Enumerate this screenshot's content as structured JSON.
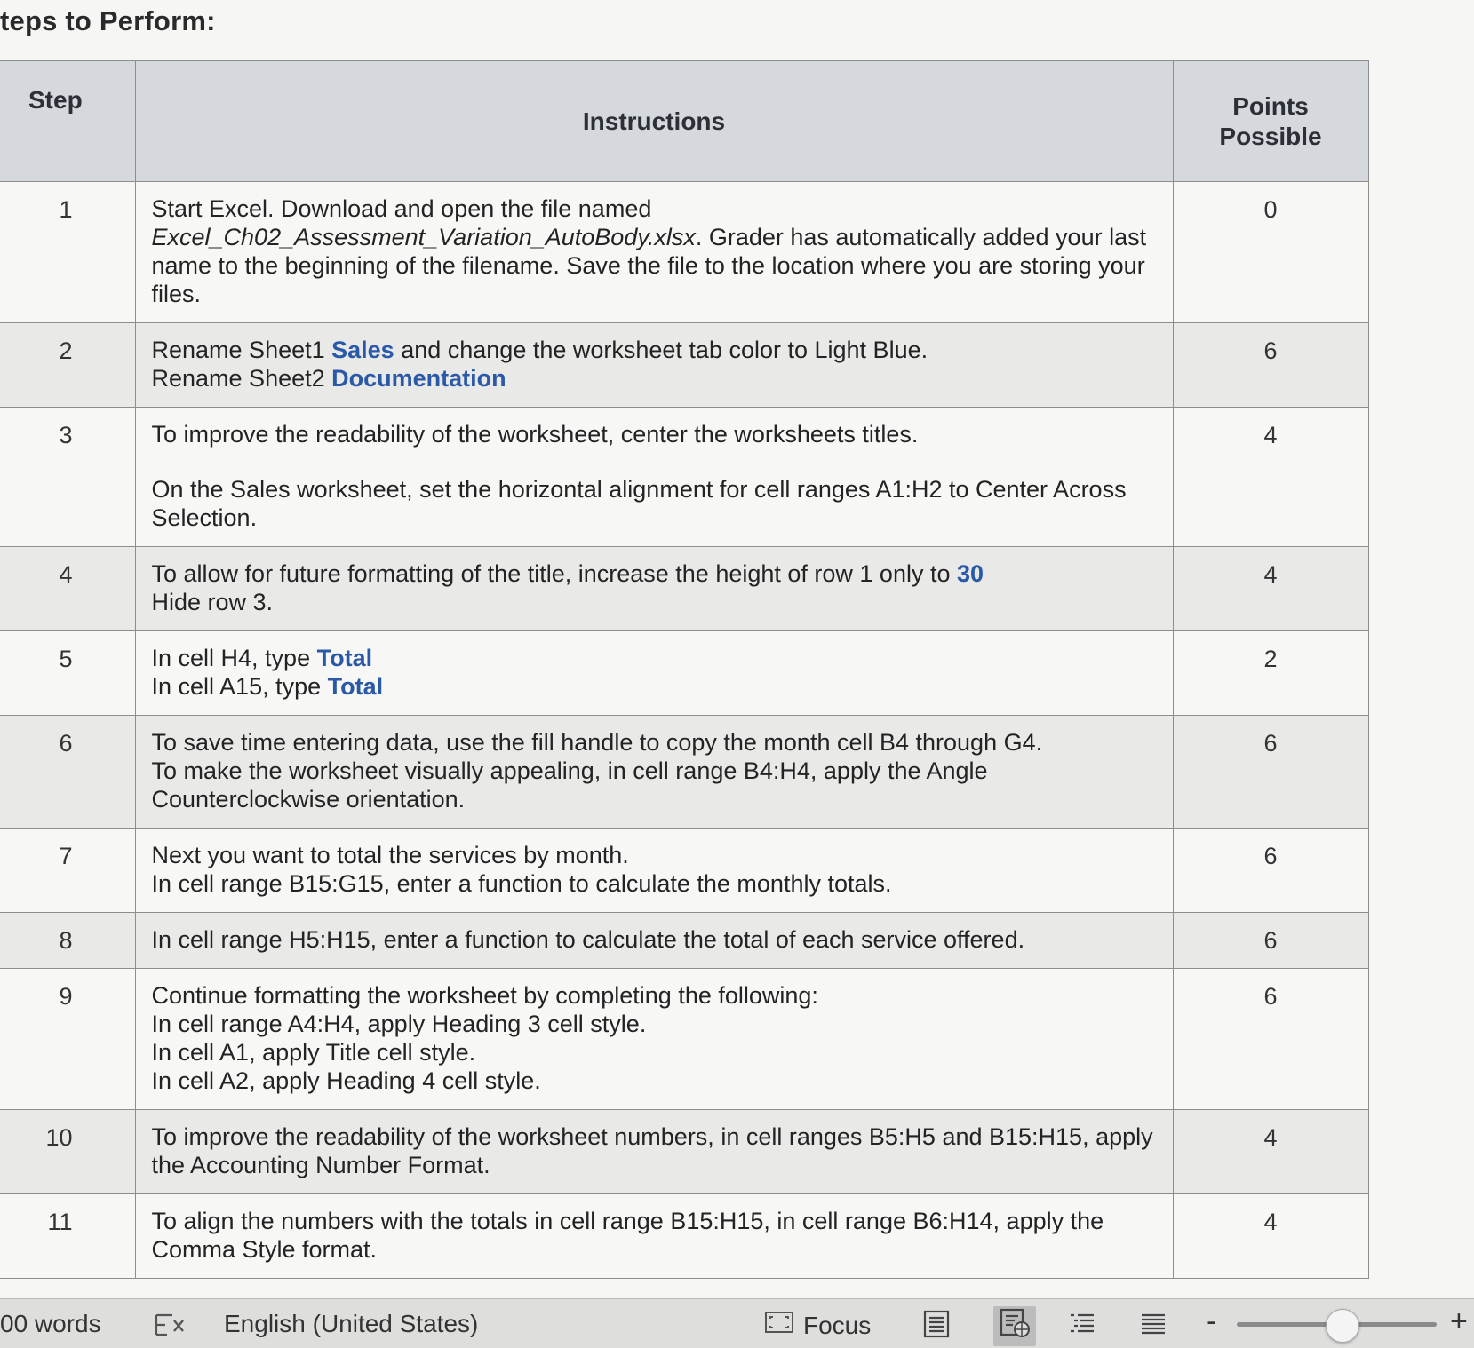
{
  "page_title": "teps to Perform:",
  "table": {
    "headers": {
      "step": "Step",
      "instructions": "Instructions",
      "points_line1": "Points",
      "points_line2": "Possible"
    },
    "rows": [
      {
        "step": "1",
        "points": "0",
        "lines": [
          [
            {
              "t": "Start Excel. Download and open the file named"
            }
          ],
          [
            {
              "t": "Excel_Ch02_Assessment_Variation_AutoBody.xlsx",
              "s": "em"
            },
            {
              "t": ". Grader has automatically added your last"
            }
          ],
          [
            {
              "t": "name to the beginning of the filename. Save the file to the location where you are storing your"
            }
          ],
          [
            {
              "t": "files."
            }
          ]
        ]
      },
      {
        "step": "2",
        "points": "6",
        "lines": [
          [
            {
              "t": "Rename Sheet1 "
            },
            {
              "t": "Sales",
              "s": "blue"
            },
            {
              "t": " and change the worksheet tab color to Light Blue."
            }
          ],
          [
            {
              "t": "Rename Sheet2 "
            },
            {
              "t": "Documentation",
              "s": "blue"
            }
          ]
        ]
      },
      {
        "step": "3",
        "points": "4",
        "lines": [
          [
            {
              "t": "To improve the readability of the worksheet, center the worksheets titles."
            }
          ],
          "gap",
          [
            {
              "t": "On the Sales worksheet, set the horizontal alignment for cell ranges A1:H2 to Center Across"
            }
          ],
          [
            {
              "t": "Selection."
            }
          ]
        ]
      },
      {
        "step": "4",
        "points": "4",
        "lines": [
          [
            {
              "t": "To allow for future formatting of the title, increase the height of row 1 only to "
            },
            {
              "t": "30",
              "s": "blue"
            }
          ],
          [
            {
              "t": "Hide row 3."
            }
          ]
        ]
      },
      {
        "step": "5",
        "points": "2",
        "lines": [
          [
            {
              "t": "In cell H4, type "
            },
            {
              "t": "Total",
              "s": "blue"
            }
          ],
          [
            {
              "t": "In cell A15, type "
            },
            {
              "t": "Total",
              "s": "blue"
            }
          ]
        ]
      },
      {
        "step": "6",
        "points": "6",
        "lines": [
          [
            {
              "t": "To save time entering data, use the fill handle to copy the month cell B4 through G4."
            }
          ],
          [
            {
              "t": "To make the worksheet visually appealing, in cell range B4:H4, apply the Angle"
            }
          ],
          [
            {
              "t": "Counterclockwise orientation."
            }
          ]
        ]
      },
      {
        "step": "7",
        "points": "6",
        "lines": [
          [
            {
              "t": "Next you want to total the services by month."
            }
          ],
          [
            {
              "t": "In cell range B15:G15, enter a function to calculate the monthly totals."
            }
          ]
        ]
      },
      {
        "step": "8",
        "points": "6",
        "lines": [
          [
            {
              "t": "In cell range H5:H15, enter a function to calculate the total of each service offered."
            }
          ]
        ]
      },
      {
        "step": "9",
        "points": "6",
        "lines": [
          [
            {
              "t": "Continue formatting the worksheet by completing the following:"
            }
          ],
          [
            {
              "t": "In cell range A4:H4, apply Heading 3 cell style."
            }
          ],
          [
            {
              "t": "In cell A1, apply Title cell style."
            }
          ],
          [
            {
              "t": "In cell A2, apply Heading 4 cell style."
            }
          ]
        ]
      },
      {
        "step": "10",
        "points": "4",
        "lines": [
          [
            {
              "t": "To improve the readability of the worksheet numbers, in cell ranges B5:H5 and B15:H15, apply"
            }
          ],
          [
            {
              "t": "the Accounting Number Format."
            }
          ]
        ]
      },
      {
        "step": "11",
        "points": "4",
        "lines": [
          [
            {
              "t": "To align the numbers with the totals in cell range B15:H15, in cell range B6:H14, apply the"
            }
          ],
          [
            {
              "t": "Comma Style format."
            }
          ]
        ]
      }
    ]
  },
  "status_bar": {
    "word_count": "00 words",
    "proofing_icon": "proofing-error-icon",
    "language": "English (United States)",
    "focus_label": "Focus",
    "focus_icon": "focus-icon",
    "views": [
      "print-layout-icon",
      "web-layout-icon",
      "outline-icon",
      "draft-icon"
    ],
    "zoom_level": 0.5
  }
}
